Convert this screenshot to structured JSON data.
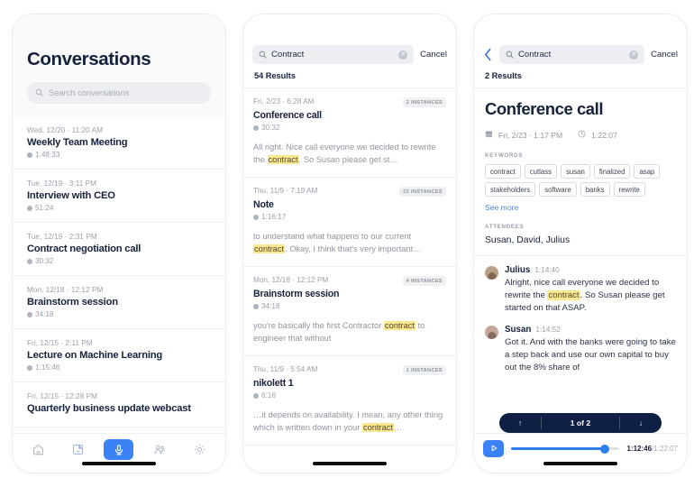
{
  "screen1": {
    "title": "Conversations",
    "search": {
      "placeholder": "Search conversations",
      "icon": "search-icon"
    },
    "conversations": [
      {
        "date": "Wed, 12/20 · 11:20 AM",
        "title": "Weekly Team Meeting",
        "duration": "1:48:33"
      },
      {
        "date": "Tue, 12/19 · 3:11 PM",
        "title": "Interview with CEO",
        "duration": "51:24"
      },
      {
        "date": "Tue, 12/19 · 2:31 PM",
        "title": "Contract negotiation call",
        "duration": "30:32"
      },
      {
        "date": "Mon, 12/18 · 12:12 PM",
        "title": "Brainstorm session",
        "duration": "34:18"
      },
      {
        "date": "Fri, 12/15 · 2:11 PM",
        "title": "Lecture on Machine Learning",
        "duration": "1:15:46"
      },
      {
        "date": "Fri, 12/15 · 12:28 PM",
        "title": "Quarterly business update webcast",
        "duration": ""
      }
    ],
    "tabbar": [
      {
        "name": "home-icon",
        "active": false
      },
      {
        "name": "notes-icon",
        "active": false
      },
      {
        "name": "microphone-icon",
        "active": true
      },
      {
        "name": "people-icon",
        "active": false
      },
      {
        "name": "gear-icon",
        "active": false
      }
    ],
    "accent": "#3b82f6"
  },
  "screen2": {
    "search": {
      "value": "Contract",
      "cancel_label": "Cancel",
      "clear_glyph": "✕"
    },
    "results_count": "54 Results",
    "results": [
      {
        "date": "Fri, 2/23 · 6:28 AM",
        "badge": "2 INSTANCES",
        "title": "Conference call",
        "duration": "30:32",
        "snippet_pre": "All right. Nice call everyone we decided to rewrite the ",
        "snippet_hl": "contract",
        "snippet_post": ". So Susan please get st…"
      },
      {
        "date": "Thu, 11/9 · 7:19 AM",
        "badge": "22 INSTANCES",
        "title": "Note",
        "duration": "1:16:17",
        "snippet_pre": " to understand what happens to our current ",
        "snippet_hl": "contract",
        "snippet_post": ". Okay, I think that's very important…"
      },
      {
        "date": "Mon, 12/18 · 12:12 PM",
        "badge": "4 INSTANCES",
        "title": "Brainstorm session",
        "duration": "34:18",
        "snippet_pre": "you're basically the first Contractor ",
        "snippet_hl": "contract",
        "snippet_post": " to engineer that without"
      },
      {
        "date": "Thu, 11/9 · 5:54 AM",
        "badge": "1 INSTANCES",
        "title": "nikolett 1",
        "duration": "6:16",
        "snippet_pre": "…it depends on availability. I mean, any other thing which is written down in your ",
        "snippet_hl": "contract",
        "snippet_post": "…"
      }
    ]
  },
  "screen3": {
    "search": {
      "value": "Contract",
      "cancel_label": "Cancel",
      "clear_glyph": "✕",
      "back_glyph": "‹"
    },
    "results_count": "2 Results",
    "detail": {
      "title": "Conference call",
      "date": "Fri, 2/23 · 1:17 PM",
      "duration": "1:22:07",
      "keywords_label": "KEYWORDS",
      "keywords": [
        "contract",
        "cutlass",
        "susan",
        "finalized",
        "asap",
        "stakeholders",
        "software",
        "banks",
        "rewrite"
      ],
      "see_more_label": "See more",
      "attendees_label": "ATTENDEES",
      "attendees": "Susan, David, Julius"
    },
    "transcript": [
      {
        "speaker": "Julius",
        "time": "1:14:40",
        "pre": "Alright, nice call everyone we decided to rewrite the ",
        "hl": "contract",
        "post": ". So Susan please get started on that ASAP."
      },
      {
        "speaker": "Susan",
        "time": "1:14:52",
        "pre": "Got it. And with the banks were going to take a step back and use our own capital to buy out the 8% share of",
        "hl": "",
        "post": ""
      }
    ],
    "jump": {
      "up_glyph": "↑",
      "label": "1 of 2",
      "down_glyph": "↓",
      "bg": "#0f2044"
    },
    "player": {
      "play_glyph": "▷",
      "current_time": "1:12:46",
      "separator": "/",
      "total_time": "1:22:07",
      "progress_pct": 86,
      "accent": "#2f7ef0"
    }
  }
}
